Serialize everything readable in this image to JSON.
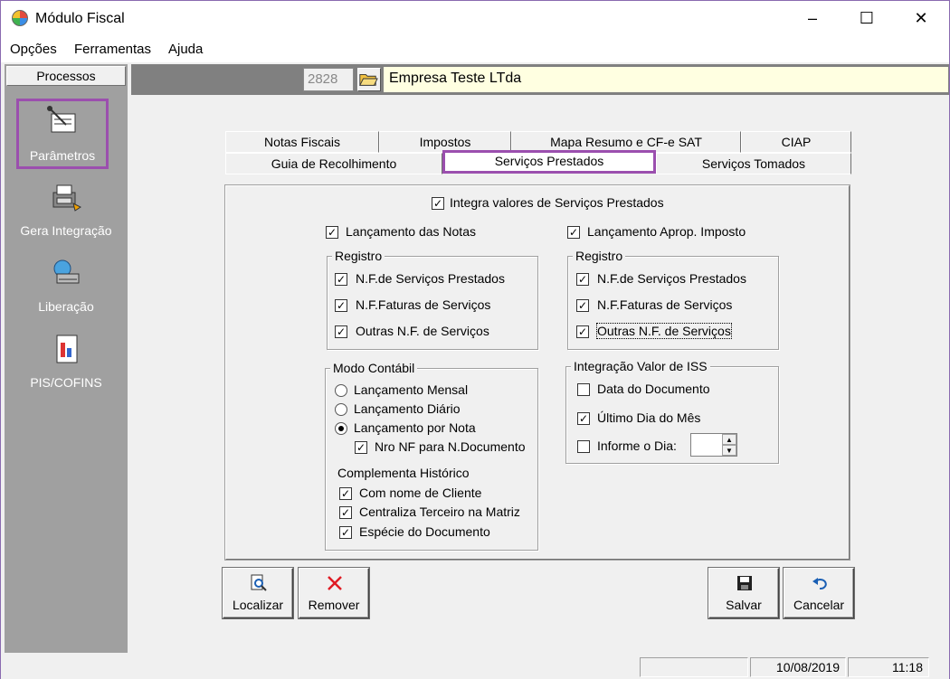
{
  "window": {
    "title": "Módulo Fiscal"
  },
  "menu": {
    "items": [
      "Opções",
      "Ferramentas",
      "Ajuda"
    ]
  },
  "sidebar": {
    "header": "Processos",
    "items": [
      {
        "label": "Parâmetros",
        "icon": "parameters-icon"
      },
      {
        "label": "Gera Integração",
        "icon": "integration-icon"
      },
      {
        "label": "Liberação",
        "icon": "release-icon"
      },
      {
        "label": "PIS/COFINS",
        "icon": "pis-cofins-icon"
      }
    ]
  },
  "company": {
    "code": "2828",
    "name": "Empresa Teste LTda"
  },
  "tabs": {
    "row1": [
      "Notas Fiscais",
      "Impostos",
      "Mapa Resumo e CF-e SAT",
      "CIAP"
    ],
    "row2": [
      "Guia de Recolhimento",
      "Serviços Prestados",
      "Serviços Tomados"
    ],
    "active": "Serviços Prestados"
  },
  "panel": {
    "integra": {
      "label": "Integra valores de Serviços Prestados",
      "checked": true
    },
    "lanc_notas": {
      "label": "Lançamento das Notas",
      "checked": true
    },
    "lanc_aprop": {
      "label": "Lançamento Aprop. Imposto",
      "checked": true
    },
    "registro_left": {
      "title": "Registro",
      "items": [
        "N.F.de Serviços Prestados",
        "N.F.Faturas de Serviços",
        "Outras N.F. de Serviços"
      ]
    },
    "registro_right": {
      "title": "Registro",
      "items": [
        "N.F.de Serviços Prestados",
        "N.F.Faturas de Serviços",
        "Outras N.F. de Serviços"
      ]
    },
    "modo_contabil": {
      "title": "Modo Contábil",
      "options": [
        "Lançamento Mensal",
        "Lançamento Diário",
        "Lançamento por Nota"
      ],
      "selected": "Lançamento por Nota",
      "nro_nf": "Nro NF para N.Documento",
      "complementa_title": "Complementa Histórico",
      "complementa_items": [
        "Com nome de Cliente",
        "Centraliza Terceiro na Matriz",
        "Espécie do Documento"
      ]
    },
    "iss": {
      "title": "Integração Valor de ISS",
      "items": [
        {
          "label": "Data do Documento",
          "checked": false
        },
        {
          "label": "Último Dia do Mês",
          "checked": true
        },
        {
          "label": "Informe o Dia:",
          "checked": false
        }
      ],
      "day_value": ""
    }
  },
  "buttons": {
    "localizar": "Localizar",
    "remover": "Remover",
    "salvar": "Salvar",
    "cancelar": "Cancelar"
  },
  "status": {
    "date": "10/08/2019",
    "time": "11:18"
  }
}
